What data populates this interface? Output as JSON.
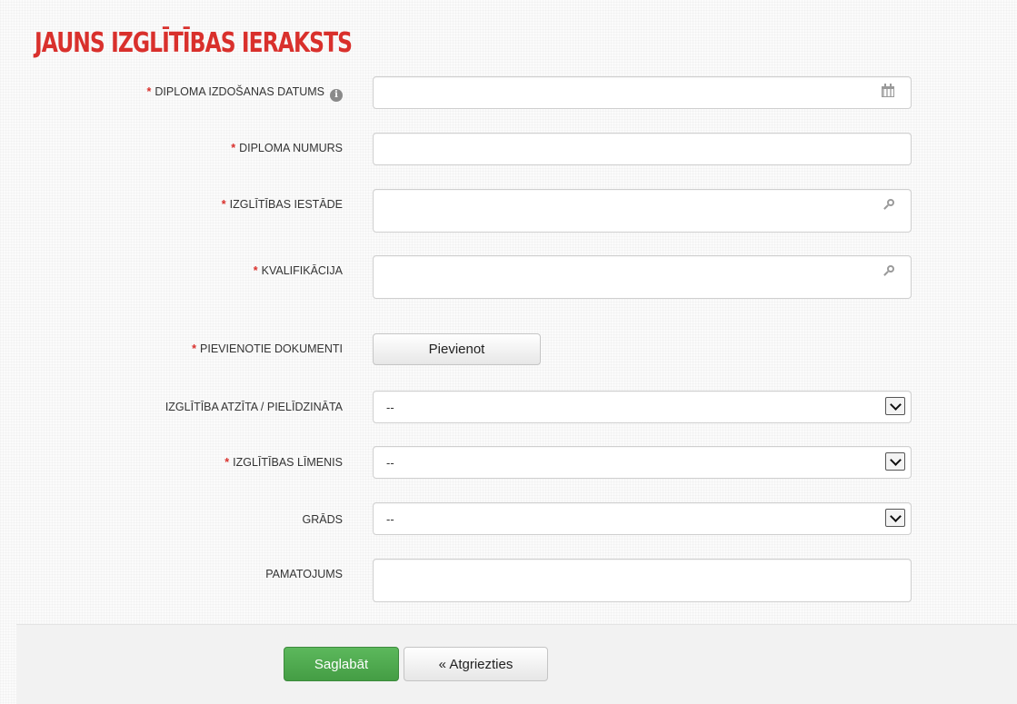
{
  "title": "JAUNS IZGLĪTĪBAS IERAKSTS",
  "required_marker": "*",
  "info_icon_glyph": "i",
  "fields": {
    "diploma_date": {
      "label": "DIPLOMA IZDOŠANAS DATUMS",
      "value": "",
      "icon": "calendar-icon"
    },
    "diploma_number": {
      "label": "DIPLOMA NUMURS",
      "value": ""
    },
    "institution": {
      "label": "IZGLĪTĪBAS IESTĀDE",
      "value": "",
      "icon": "search-icon"
    },
    "qualification": {
      "label": "KVALIFIKĀCIJA",
      "value": "",
      "icon": "search-icon"
    },
    "documents": {
      "label": "PIEVIENOTIE DOKUMENTI",
      "button_label": "Pievienot"
    },
    "recognized": {
      "label": "IZGLĪTĪBA ATZĪTA / PIELĪDZINĀTA",
      "value": "--"
    },
    "level": {
      "label": "IZGLĪTĪBAS LĪMENIS",
      "value": "--"
    },
    "degree": {
      "label": "GRĀDS",
      "value": "--"
    },
    "justification": {
      "label": "PAMATOJUMS",
      "value": ""
    }
  },
  "footer": {
    "save_label": "Saglabāt",
    "back_label": "« Atgriezties"
  },
  "colors": {
    "accent_red": "#d9302c",
    "save_green": "#5cb85c"
  }
}
